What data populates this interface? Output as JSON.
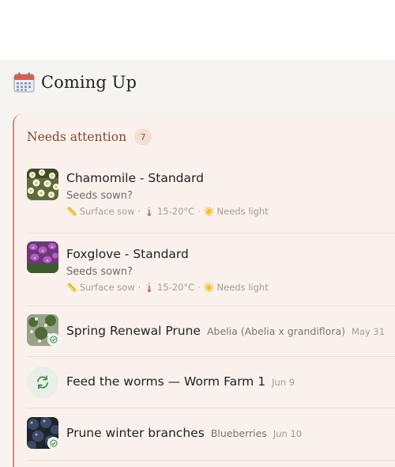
{
  "section": {
    "title": "Coming Up",
    "icon": "calendar-icon"
  },
  "card": {
    "title": "Needs attention",
    "count": "7",
    "accent": "#d58d6c"
  },
  "items": [
    {
      "title": "Chamomile - Standard",
      "prompt": "Seeds sown?",
      "meta": {
        "sow": "Surface sow",
        "temp": "15-20°C",
        "light": "Needs light"
      },
      "thumb": "chamomile-photo"
    },
    {
      "title": "Foxglove - Standard",
      "prompt": "Seeds sown?",
      "meta": {
        "sow": "Surface sow",
        "temp": "15-20°C",
        "light": "Needs light"
      },
      "thumb": "foxglove-photo"
    },
    {
      "title": "Spring Renewal Prune",
      "subtitle": "Abelia (Abelia x grandiflora)",
      "date": "May 31",
      "thumb": "abelia-photo"
    },
    {
      "title": "Feed the worms — Worm Farm 1",
      "date": "Jun 9",
      "icon": "sync-icon"
    },
    {
      "title": "Prune winter branches",
      "subtitle": "Blueberries",
      "date": "Jun 10",
      "thumb": "blueberries-photo"
    }
  ],
  "meta_separator": "·"
}
